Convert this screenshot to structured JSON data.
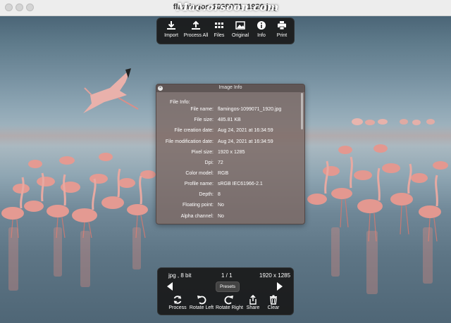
{
  "window": {
    "title": "flamingos-1099071_1920.jpg",
    "watermark": "Mac.orsoon.com"
  },
  "toolbar": {
    "items": [
      {
        "label": "Import",
        "icon": "import-icon"
      },
      {
        "label": "Process All",
        "icon": "process-all-icon"
      },
      {
        "label": "Files",
        "icon": "grid-icon"
      },
      {
        "label": "Original",
        "icon": "image-icon"
      },
      {
        "label": "Info",
        "icon": "info-icon"
      },
      {
        "label": "Print",
        "icon": "printer-icon"
      }
    ]
  },
  "info_panel": {
    "title": "Image Info",
    "section": "File Info:",
    "rows": [
      {
        "key": "File name:",
        "value": "flamingos-1099071_1920.jpg"
      },
      {
        "key": "File size:",
        "value": "485.81 KB"
      },
      {
        "key": "File creation date:",
        "value": "Aug 24, 2021 at 16:34:59"
      },
      {
        "key": "File modification date:",
        "value": "Aug 24, 2021 at 16:34:59"
      },
      {
        "key": "Pixel size:",
        "value": "1920 x 1285"
      },
      {
        "key": "Dpi:",
        "value": "72"
      },
      {
        "key": "Color model:",
        "value": "RGB"
      },
      {
        "key": "Profile name:",
        "value": "sRGB IEC61966-2.1"
      },
      {
        "key": "Depth:",
        "value": "8"
      },
      {
        "key": "Floating point:",
        "value": "No"
      },
      {
        "key": "Alpha channel:",
        "value": "No"
      }
    ]
  },
  "bottombar": {
    "format": "jpg , 8 bit",
    "page": "1 / 1",
    "dimensions": "1920 x 1285",
    "presets_label": "Presets",
    "actions": [
      {
        "label": "Process",
        "icon": "refresh-icon"
      },
      {
        "label": "Rotate Left",
        "icon": "rotate-left-icon"
      },
      {
        "label": "Rotate Right",
        "icon": "rotate-right-icon"
      },
      {
        "label": "Share",
        "icon": "share-icon"
      },
      {
        "label": "Clear",
        "icon": "trash-icon"
      }
    ]
  }
}
